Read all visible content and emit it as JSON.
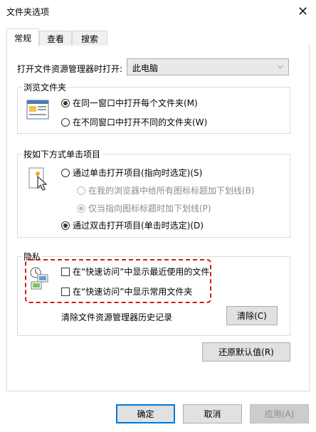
{
  "window": {
    "title": "文件夹选项",
    "close_glyph": "✕"
  },
  "tabs": [
    {
      "label": "常规",
      "active": true
    },
    {
      "label": "查看",
      "active": false
    },
    {
      "label": "搜索",
      "active": false
    }
  ],
  "open_explorer": {
    "label": "打开文件资源管理器时打开:",
    "value": "此电脑",
    "arrow": "⌵"
  },
  "browse_folders": {
    "title": "浏览文件夹",
    "options": [
      {
        "label": "在同一窗口中打开每个文件夹(M)",
        "checked": true
      },
      {
        "label": "在不同窗口中打开不同的文件夹(W)",
        "checked": false
      }
    ]
  },
  "click_items": {
    "title": "按如下方式单击项目",
    "options": [
      {
        "label": "通过单击打开项目(指向时选定)(S)",
        "checked": false,
        "disabled": false
      },
      {
        "label": "在我的浏览器中给所有图标标题加下划线(B)",
        "checked": false,
        "disabled": true
      },
      {
        "label": "仅当指向图标标题时加下划线(P)",
        "checked": true,
        "disabled": true
      },
      {
        "label": "通过双击打开项目(单击时选定)(D)",
        "checked": true,
        "disabled": false
      }
    ]
  },
  "privacy": {
    "title": "隐私",
    "checkboxes": [
      {
        "label": "在“快速访问”中显示最近使用的文件",
        "checked": false
      },
      {
        "label": "在“快速访问”中显示常用文件夹",
        "checked": false
      }
    ],
    "clear_label": "清除文件资源管理器历史记录",
    "clear_button": "清除(C)"
  },
  "restore_defaults_button": "还原默认值(R)",
  "footer": {
    "ok": "确定",
    "cancel": "取消",
    "apply": "应用(A)"
  },
  "colors": {
    "highlight": "#d41a1a",
    "accent": "#0078d7"
  }
}
